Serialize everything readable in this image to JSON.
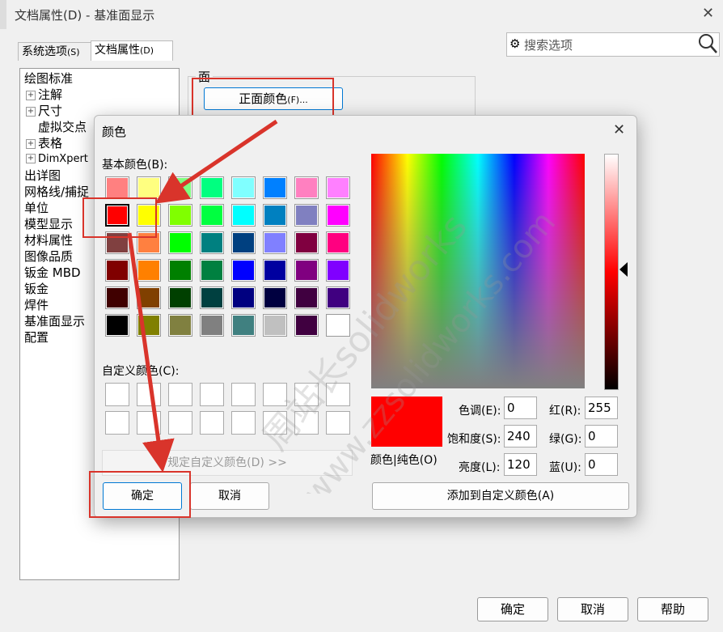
{
  "main_window": {
    "title": "文档属性(D) - 基准面显示",
    "tabs": [
      {
        "label": "系统选项",
        "key": "(S)"
      },
      {
        "label": "文档属性",
        "key": "(D)"
      }
    ],
    "search_placeholder": "搜索选项",
    "tree": [
      {
        "label": "绘图标准",
        "expand": ""
      },
      {
        "label": "注解",
        "expand": "+"
      },
      {
        "label": "尺寸",
        "expand": "+"
      },
      {
        "label": "虚拟交点",
        "expand": ""
      },
      {
        "label": "表格",
        "expand": "+"
      },
      {
        "label": "DimXpert",
        "expand": "+"
      },
      {
        "label": "出详图",
        "expand": ""
      },
      {
        "label": "网格线/捕捉",
        "expand": ""
      },
      {
        "label": "单位",
        "expand": ""
      },
      {
        "label": "模型显示",
        "expand": ""
      },
      {
        "label": "材料属性",
        "expand": ""
      },
      {
        "label": "图像品质",
        "expand": ""
      },
      {
        "label": "钣金 MBD",
        "expand": ""
      },
      {
        "label": "钣金",
        "expand": ""
      },
      {
        "label": "焊件",
        "expand": ""
      },
      {
        "label": "基准面显示",
        "expand": ""
      },
      {
        "label": "配置",
        "expand": ""
      }
    ],
    "face_group_label": "面",
    "front_color_button": {
      "label": "正面颜色",
      "key": "(F)..."
    },
    "buttons": {
      "ok": "确定",
      "cancel": "取消",
      "help": "帮助"
    }
  },
  "color_dialog": {
    "title": "颜色",
    "basic_colors_label": "基本颜色(B):",
    "basic_colors": [
      [
        "#ff8080",
        "#ffff80",
        "#80ff80",
        "#00ff80",
        "#80ffff",
        "#0080ff",
        "#ff80c0",
        "#ff80ff"
      ],
      [
        "#ff0000",
        "#ffff00",
        "#80ff00",
        "#00ff40",
        "#00ffff",
        "#0080c0",
        "#8080c0",
        "#ff00ff"
      ],
      [
        "#804040",
        "#ff8040",
        "#00ff00",
        "#008080",
        "#004080",
        "#8080ff",
        "#800040",
        "#ff0080"
      ],
      [
        "#800000",
        "#ff8000",
        "#008000",
        "#008040",
        "#0000ff",
        "#0000a0",
        "#800080",
        "#8000ff"
      ],
      [
        "#400000",
        "#804000",
        "#004000",
        "#004040",
        "#000080",
        "#000040",
        "#400040",
        "#400080"
      ],
      [
        "#000000",
        "#808000",
        "#808040",
        "#808080",
        "#408080",
        "#c0c0c0",
        "#400040",
        "#ffffff"
      ]
    ],
    "selected_basic": [
      1,
      0
    ],
    "custom_colors_label": "自定义颜色(C):",
    "define_custom_button": "规定自定义颜色(D) >>",
    "ok_button": "确定",
    "cancel_button": "取消",
    "preview_label": "颜色|纯色(O)",
    "preview_color": "#ff0000",
    "fields": {
      "hue": {
        "label": "色调(E):",
        "value": "0"
      },
      "sat": {
        "label": "饱和度(S):",
        "value": "240"
      },
      "lum": {
        "label": "亮度(L):",
        "value": "120"
      },
      "red": {
        "label": "红(R):",
        "value": "255"
      },
      "green": {
        "label": "绿(G):",
        "value": "0"
      },
      "blue": {
        "label": "蓝(U):",
        "value": "0"
      }
    },
    "add_custom_button": "添加到自定义颜色(A)"
  },
  "watermark": {
    "line1": "周站长solidworks",
    "line2": "www.zzsolidworks.com"
  },
  "annotation_color": "#d9342b"
}
